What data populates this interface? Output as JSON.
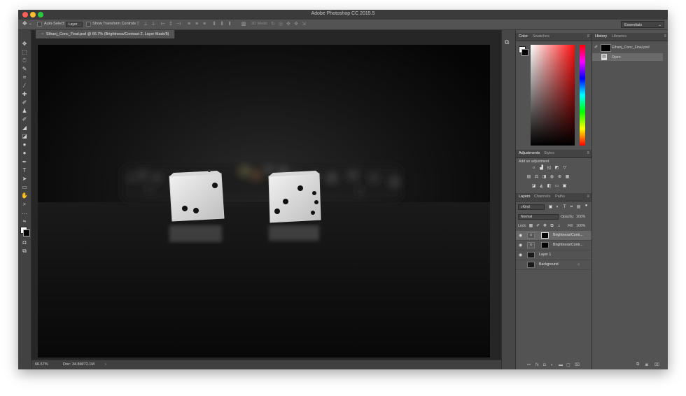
{
  "app": {
    "title": "Adobe Photoshop CC 2015.5"
  },
  "options_bar": {
    "auto_select_label": "Auto-Select:",
    "auto_select_value": "Layer",
    "transform_label": "Show Transform Controls",
    "mode_3d_label": "3D Mode:",
    "workspace": "Essentials"
  },
  "document": {
    "tab_title": "Ethanj_Conc_Final.psd @ 66.7% (Brightness/Contrast 2, Layer Mask/8)",
    "close_glyph": "×"
  },
  "status": {
    "zoom": "66.67%",
    "doc_info": "Doc: 34.8M/72.1M",
    "arrow": "›"
  },
  "color_panel": {
    "tabs": [
      "Color",
      "Swatches"
    ]
  },
  "adjustments_panel": {
    "tabs": [
      "Adjustments",
      "Styles"
    ],
    "hint": "Add an adjustment"
  },
  "layers_panel": {
    "tabs": [
      "Layers",
      "Channels",
      "Paths"
    ],
    "kind_label": "Kind",
    "blend_mode": "Normal",
    "opacity_label": "Opacity:",
    "opacity_value": "100%",
    "lock_label": "Lock:",
    "fill_label": "Fill:",
    "fill_value": "100%",
    "layers": [
      {
        "name": "Brightness/Contr..."
      },
      {
        "name": "Brightness/Contr..."
      },
      {
        "name": "Layer 1"
      },
      {
        "name": "Background"
      }
    ]
  },
  "history_panel": {
    "tabs": [
      "History",
      "Libraries"
    ],
    "snapshot": "Ethanj_Conc_Final.psd",
    "states": [
      "Open"
    ]
  },
  "colors": {
    "close": "#fc5f57",
    "minimize": "#fdbc2e",
    "zoom": "#29c840"
  }
}
